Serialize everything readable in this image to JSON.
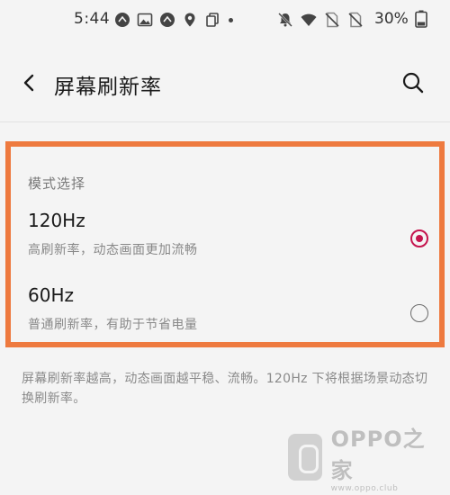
{
  "status_bar": {
    "time": "5:44",
    "battery_percent": "30%",
    "left_icons": [
      "notification-icon",
      "image-icon",
      "notification-icon",
      "location-pin-icon",
      "copy-icon",
      "more-dot-icon"
    ],
    "right_icons": [
      "bell-off-icon",
      "wifi-icon",
      "no-sim-icon",
      "no-sim-icon",
      "battery-icon"
    ]
  },
  "header": {
    "title": "屏幕刷新率",
    "back_icon": "chevron-left-icon",
    "search_icon": "search-icon"
  },
  "mode_section": {
    "header": "模式选择",
    "options": [
      {
        "title": "120Hz",
        "description": "高刷新率，动态画面更加流畅",
        "selected": true
      },
      {
        "title": "60Hz",
        "description": "普通刷新率，有助于节省电量",
        "selected": false
      }
    ]
  },
  "footer_note": "屏幕刷新率越高，动态画面越平稳、流畅。120Hz 下将根据场景动态切换刷新率。",
  "watermark": {
    "brand": "OPPO之家",
    "url": "www.oppo.club"
  },
  "colors": {
    "accent": "#c5154e",
    "highlight_border": "#ee7a3f",
    "background": "#f4f4f4"
  }
}
